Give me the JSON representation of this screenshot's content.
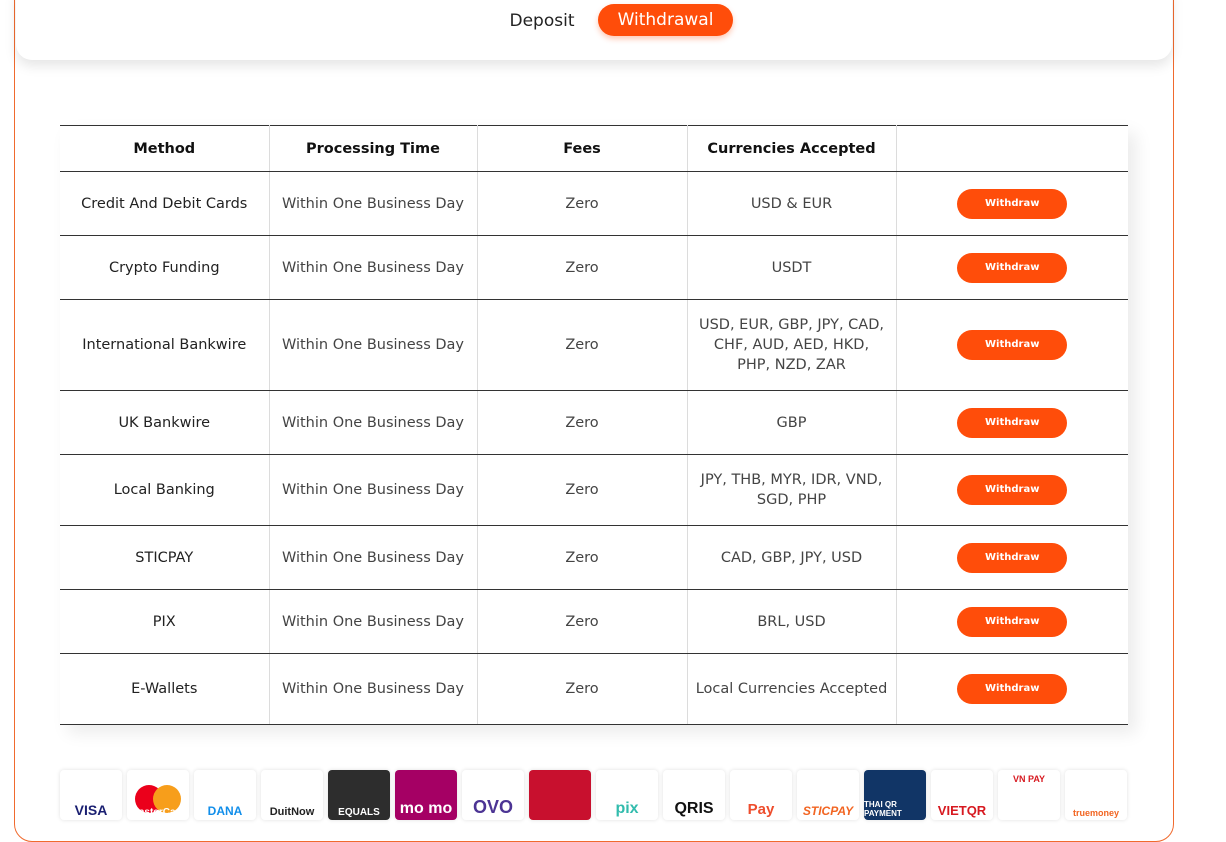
{
  "tabs": {
    "deposit": "Deposit",
    "withdrawal": "Withdrawal"
  },
  "table": {
    "headers": [
      "Method",
      "Processing Time",
      "Fees",
      "Currencies Accepted",
      ""
    ],
    "rows": [
      {
        "method": "Credit And Debit Cards",
        "time": "Within One Business Day",
        "fees": "Zero",
        "currencies": "USD & EUR",
        "action": "Withdraw"
      },
      {
        "method": "Crypto Funding",
        "time": "Within One Business Day",
        "fees": "Zero",
        "currencies": "USDT",
        "action": "Withdraw"
      },
      {
        "method": "International Bankwire",
        "time": "Within One Business Day",
        "fees": "Zero",
        "currencies": "USD, EUR, GBP, JPY, CAD, CHF, AUD, AED, HKD, PHP, NZD, ZAR",
        "action": "Withdraw"
      },
      {
        "method": "UK Bankwire",
        "time": "Within One Business Day",
        "fees": "Zero",
        "currencies": "GBP",
        "action": "Withdraw"
      },
      {
        "method": "Local Banking",
        "time": "Within One Business Day",
        "fees": "Zero",
        "currencies": "JPY, THB, MYR, IDR, VND, SGD, PHP",
        "action": "Withdraw"
      },
      {
        "method": "STICPAY",
        "time": "Within One Business Day",
        "fees": "Zero",
        "currencies": "CAD, GBP, JPY, USD",
        "action": "Withdraw"
      },
      {
        "method": "PIX",
        "time": "Within One Business Day",
        "fees": "Zero",
        "currencies": "BRL, USD",
        "action": "Withdraw"
      },
      {
        "method": "E-Wallets",
        "time": "Within One Business Day",
        "fees": "Zero",
        "currencies": "Local Currencies Accepted",
        "action": "Withdraw"
      }
    ]
  },
  "logos": [
    {
      "name": "visa-logo",
      "text": "VISA",
      "color": "#1a1f71",
      "bg": "#ffffff"
    },
    {
      "name": "mastercard-logo",
      "text": "MasterCard",
      "color": "#ffffff",
      "bg": "#ffffff"
    },
    {
      "name": "dana-logo",
      "text": "DANA",
      "color": "#118eea",
      "bg": "#ffffff"
    },
    {
      "name": "duitnow-logo",
      "text": "DuitNow",
      "color": "#222222",
      "bg": "#ffffff"
    },
    {
      "name": "equals-logo",
      "text": "EQUALS",
      "color": "#ffffff",
      "bg": "#2d2d2d"
    },
    {
      "name": "momo-logo",
      "text": "mo mo",
      "color": "#ffffff",
      "bg": "#a50064"
    },
    {
      "name": "ovo-logo",
      "text": "OVO",
      "color": "#4c3494",
      "bg": "#ffffff"
    },
    {
      "name": "prima-logo",
      "text": "",
      "color": "#ffffff",
      "bg": "#c8102e"
    },
    {
      "name": "pix-logo",
      "text": "pix",
      "color": "#32bcad",
      "bg": "#ffffff"
    },
    {
      "name": "qris-logo",
      "text": "QRIS",
      "color": "#111111",
      "bg": "#ffffff"
    },
    {
      "name": "shopeepay-logo",
      "text": "Pay",
      "color": "#ee4d2d",
      "bg": "#ffffff"
    },
    {
      "name": "sticpay-logo",
      "text": "STICPAY",
      "color": "#f26522",
      "bg": "#ffffff"
    },
    {
      "name": "thaiqr-logo",
      "text": "THAI QR PAYMENT",
      "color": "#ffffff",
      "bg": "#113566"
    },
    {
      "name": "vietqr-logo",
      "text": "VIETQR",
      "color": "#d71920",
      "bg": "#ffffff"
    },
    {
      "name": "vnpay-logo",
      "text": "VN PAY",
      "color": "#d71920",
      "bg": "#ffffff"
    },
    {
      "name": "truemoney-logo",
      "text": "truemoney",
      "color": "#f26522",
      "bg": "#ffffff"
    }
  ]
}
